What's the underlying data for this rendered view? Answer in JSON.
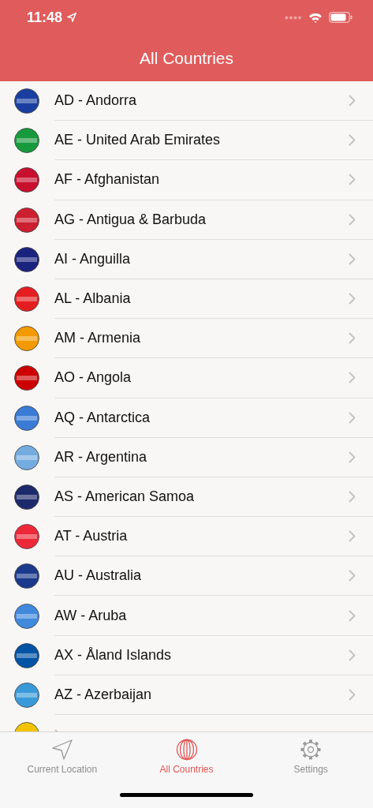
{
  "status_bar": {
    "time": "11:48"
  },
  "nav": {
    "title": "All Countries"
  },
  "countries": [
    {
      "label": "AD - Andorra",
      "color": "#1a3fa0"
    },
    {
      "label": "AE - United Arab Emirates",
      "color": "#179a3c"
    },
    {
      "label": "AF - Afghanistan",
      "color": "#c8102e"
    },
    {
      "label": "AG - Antigua & Barbuda",
      "color": "#cc1f2f"
    },
    {
      "label": "AI - Anguilla",
      "color": "#1a237e"
    },
    {
      "label": "AL - Albania",
      "color": "#e41e20"
    },
    {
      "label": "AM - Armenia",
      "color": "#f29a00"
    },
    {
      "label": "AO - Angola",
      "color": "#cc0000"
    },
    {
      "label": "AQ - Antarctica",
      "color": "#3a7bd5"
    },
    {
      "label": "AR - Argentina",
      "color": "#74acdf"
    },
    {
      "label": "AS - American Samoa",
      "color": "#1c2a6b"
    },
    {
      "label": "AT - Austria",
      "color": "#ed2939"
    },
    {
      "label": "AU - Australia",
      "color": "#1b3a8c"
    },
    {
      "label": "AW - Aruba",
      "color": "#4189dd"
    },
    {
      "label": "AX - Åland Islands",
      "color": "#0053a5"
    },
    {
      "label": "AZ - Azerbaijan",
      "color": "#3a9ad9"
    },
    {
      "color": "#f2c300"
    }
  ],
  "tabs": [
    {
      "label": "Current Location",
      "kind": "location",
      "selected": false
    },
    {
      "label": "All Countries",
      "kind": "globe",
      "selected": true
    },
    {
      "label": "Settings",
      "kind": "gear",
      "selected": false
    }
  ]
}
